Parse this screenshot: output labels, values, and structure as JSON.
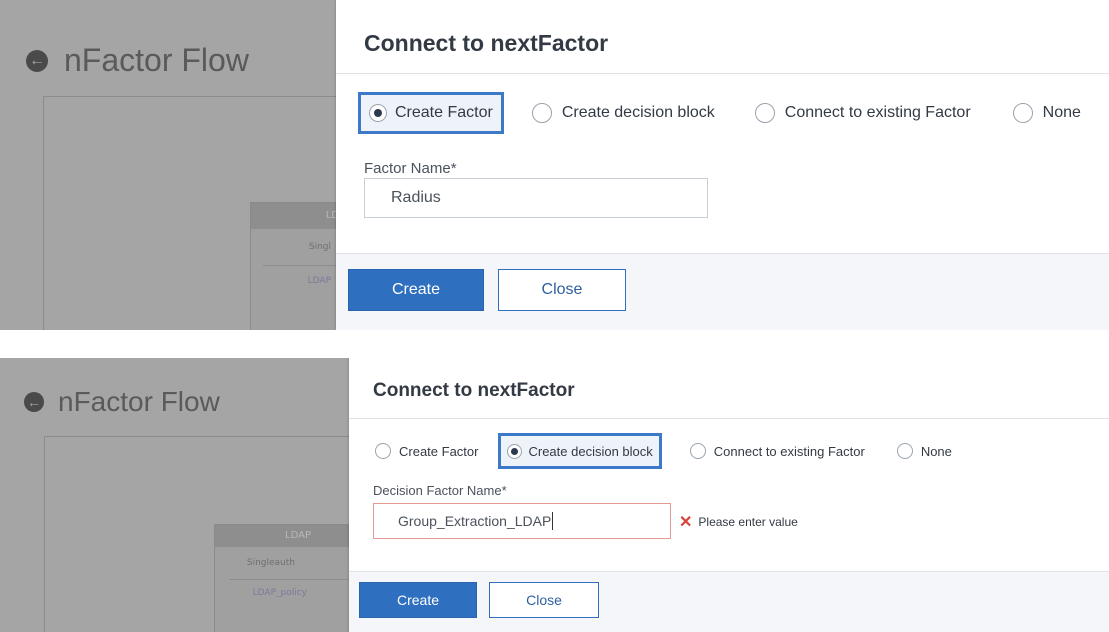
{
  "top": {
    "background": {
      "title": "nFactor Flow",
      "node_header": "LD",
      "node_cell": "Singl",
      "node_link": "LDAP"
    },
    "dialog": {
      "title": "Connect to nextFactor",
      "radio_options": [
        "Create Factor",
        "Create decision block",
        "Connect to existing Factor",
        "None"
      ],
      "selected_index": 0,
      "field_label": "Factor Name*",
      "field_value": "Radius",
      "create_label": "Create",
      "close_label": "Close"
    }
  },
  "bottom": {
    "background": {
      "title": "nFactor Flow",
      "node_header": "LDAP",
      "node_cell": "Singleauth",
      "node_link": "LDAP_policy"
    },
    "dialog": {
      "title": "Connect to nextFactor",
      "radio_options": [
        "Create Factor",
        "Create decision block",
        "Connect to existing Factor",
        "None"
      ],
      "selected_index": 1,
      "field_label": "Decision Factor Name*",
      "field_value": "Group_Extraction_LDAP",
      "error_message": "Please enter value",
      "create_label": "Create",
      "close_label": "Close"
    }
  },
  "colors": {
    "accent": "#3c79c9",
    "primary_button": "#2f6fc0",
    "error": "#d9413a",
    "overlay": "#a5a5a5"
  }
}
